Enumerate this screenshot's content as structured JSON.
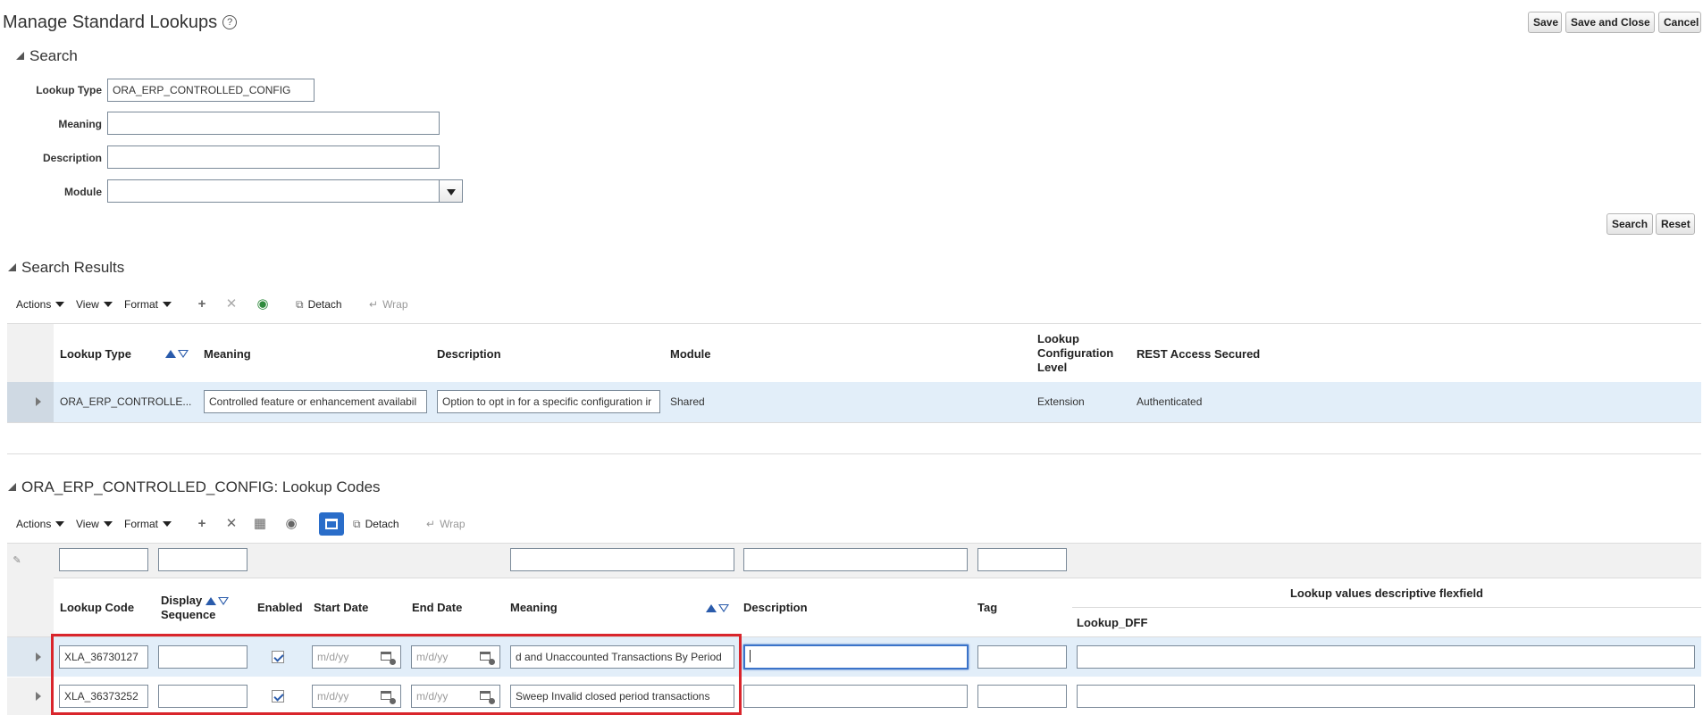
{
  "page": {
    "title": "Manage Standard Lookups"
  },
  "header_buttons": {
    "save": "Save",
    "save_close": "Save and Close",
    "cancel": "Cancel"
  },
  "search": {
    "title": "Search",
    "fields": {
      "lookup_type_label": "Lookup Type",
      "lookup_type_value": "ORA_ERP_CONTROLLED_CONFIG",
      "meaning_label": "Meaning",
      "meaning_value": "",
      "description_label": "Description",
      "description_value": "",
      "module_label": "Module",
      "module_value": ""
    },
    "search_button": "Search",
    "reset_button": "Reset"
  },
  "results": {
    "title": "Search Results",
    "toolbar": {
      "actions": "Actions",
      "view": "View",
      "format": "Format",
      "detach": "Detach",
      "wrap": "Wrap"
    },
    "columns": {
      "lookup_type": "Lookup Type",
      "meaning": "Meaning",
      "description": "Description",
      "module": "Module",
      "config_level": "Lookup Configuration Level",
      "config_level_l1": "Lookup",
      "config_level_l2": "Configuration",
      "config_level_l3": "Level",
      "rest": "REST Access Secured"
    },
    "rows": [
      {
        "lookup_type": "ORA_ERP_CONTROLLE...",
        "meaning": "Controlled feature or enhancement availabil",
        "description": "Option to opt in for a specific configuration ir",
        "module": "Shared",
        "config_level": "Extension",
        "rest": "Authenticated"
      }
    ]
  },
  "codes": {
    "title": "ORA_ERP_CONTROLLED_CONFIG: Lookup Codes",
    "toolbar": {
      "actions": "Actions",
      "view": "View",
      "format": "Format",
      "detach": "Detach",
      "wrap": "Wrap"
    },
    "columns": {
      "lookup_code": "Lookup Code",
      "display_seq_l1": "Display",
      "display_seq_l2": "Sequence",
      "enabled": "Enabled",
      "start_date": "Start Date",
      "end_date": "End Date",
      "meaning": "Meaning",
      "description": "Description",
      "tag": "Tag",
      "flexfield_group": "Lookup values descriptive flexfield",
      "lookup_dff": "Lookup_DFF"
    },
    "date_placeholder": "m/d/yy",
    "rows": [
      {
        "code": "XLA_36730127",
        "display_seq": "",
        "enabled": true,
        "start_date": "",
        "end_date": "",
        "meaning": "d and Unaccounted Transactions By Period",
        "description": "",
        "tag": "",
        "dff": ""
      },
      {
        "code": "XLA_36373252",
        "display_seq": "",
        "enabled": true,
        "start_date": "",
        "end_date": "",
        "meaning": "Sweep Invalid closed period transactions",
        "description": "",
        "tag": "",
        "dff": ""
      }
    ]
  },
  "colors": {
    "accent": "#2a6dc9",
    "highlight_row": "#e2eef9",
    "annotation_red": "#d9252c"
  }
}
